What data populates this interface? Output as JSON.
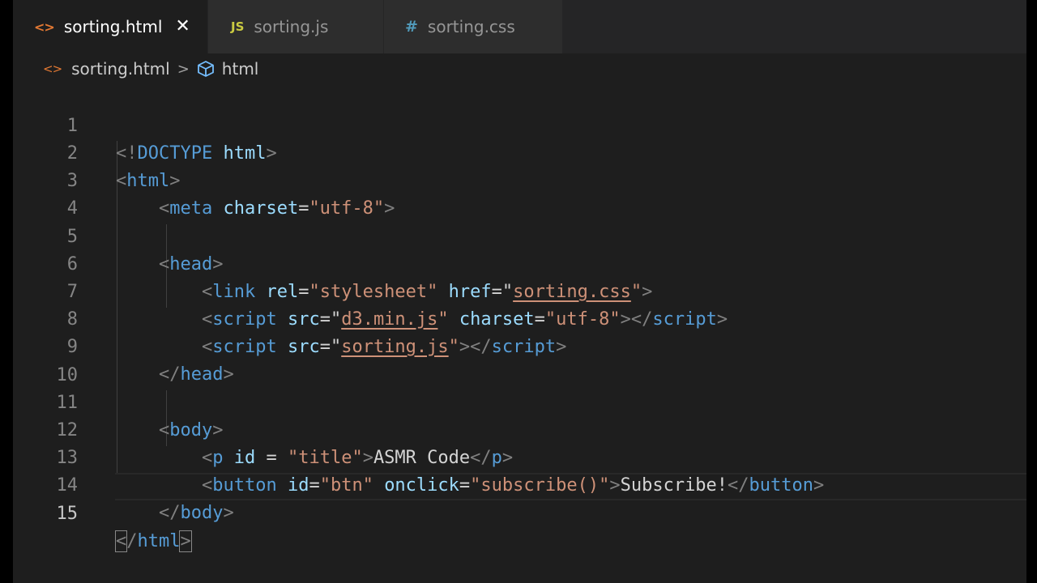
{
  "tabs": [
    {
      "label": "sorting.html",
      "icon": "<>",
      "active": true
    },
    {
      "label": "sorting.js",
      "icon": "JS"
    },
    {
      "label": "sorting.css",
      "icon": "#"
    }
  ],
  "tab_close_glyph": "✕",
  "breadcrumb": {
    "file_icon": "<>",
    "file": "sorting.html",
    "separator": ">",
    "symbol": "html"
  },
  "line_numbers": [
    "1",
    "2",
    "3",
    "4",
    "5",
    "6",
    "7",
    "8",
    "9",
    "10",
    "11",
    "12",
    "13",
    "14",
    "15"
  ],
  "current_line": "15",
  "code": {
    "l1": {
      "open": "<!",
      "doctype": "DOCTYPE",
      "name": "html",
      "close": ">"
    },
    "l2": {
      "open": "<",
      "tag": "html",
      "close": ">"
    },
    "l3": {
      "open": "<",
      "tag": "meta",
      "attr": "charset",
      "eq": "=",
      "value": "\"utf-8\"",
      "close": ">"
    },
    "l5": {
      "open": "<",
      "tag": "head",
      "close": ">"
    },
    "l6": {
      "open": "<",
      "tag": "link",
      "attr1": "rel",
      "eq1": "=",
      "value1": "\"stylesheet\"",
      "attr2": "href",
      "eq2": "=\"",
      "link": "sorting.css",
      "q": "\"",
      "close": ">"
    },
    "l7": {
      "open": "<",
      "tag": "script",
      "attr1": "src",
      "eq1": "=\"",
      "link": "d3.min.js",
      "q": "\"",
      "attr2": "charset",
      "eq2": "=",
      "value2": "\"utf-8\"",
      "close": "></",
      "tag2": "script",
      "end": ">"
    },
    "l8": {
      "open": "<",
      "tag": "script",
      "attr1": "src",
      "eq1": "=\"",
      "link": "sorting.js",
      "q": "\"",
      "close": "></",
      "tag2": "script",
      "end": ">"
    },
    "l9": {
      "open": "</",
      "tag": "head",
      "close": ">"
    },
    "l11": {
      "open": "<",
      "tag": "body",
      "close": ">"
    },
    "l12": {
      "open": "<",
      "tag": "p",
      "attr": "id",
      "eq": " = ",
      "value": "\"title\"",
      "close": ">",
      "text": "ASMR Code",
      "open2": "</",
      "tag2": "p",
      "end": ">"
    },
    "l13": {
      "open": "<",
      "tag": "button",
      "attr1": "id",
      "eq1": "=",
      "value1": "\"btn\"",
      "attr2": "onclick",
      "eq2": "=",
      "value2": "\"subscribe()\"",
      "close": ">",
      "text": "Subscribe!",
      "open2": "</",
      "tag2": "button",
      "end": ">"
    },
    "l14": {
      "open": "</",
      "tag": "body",
      "close": ">"
    },
    "l15": {
      "open": "<",
      "slash": "/",
      "tag": "html",
      "close": ">"
    }
  }
}
